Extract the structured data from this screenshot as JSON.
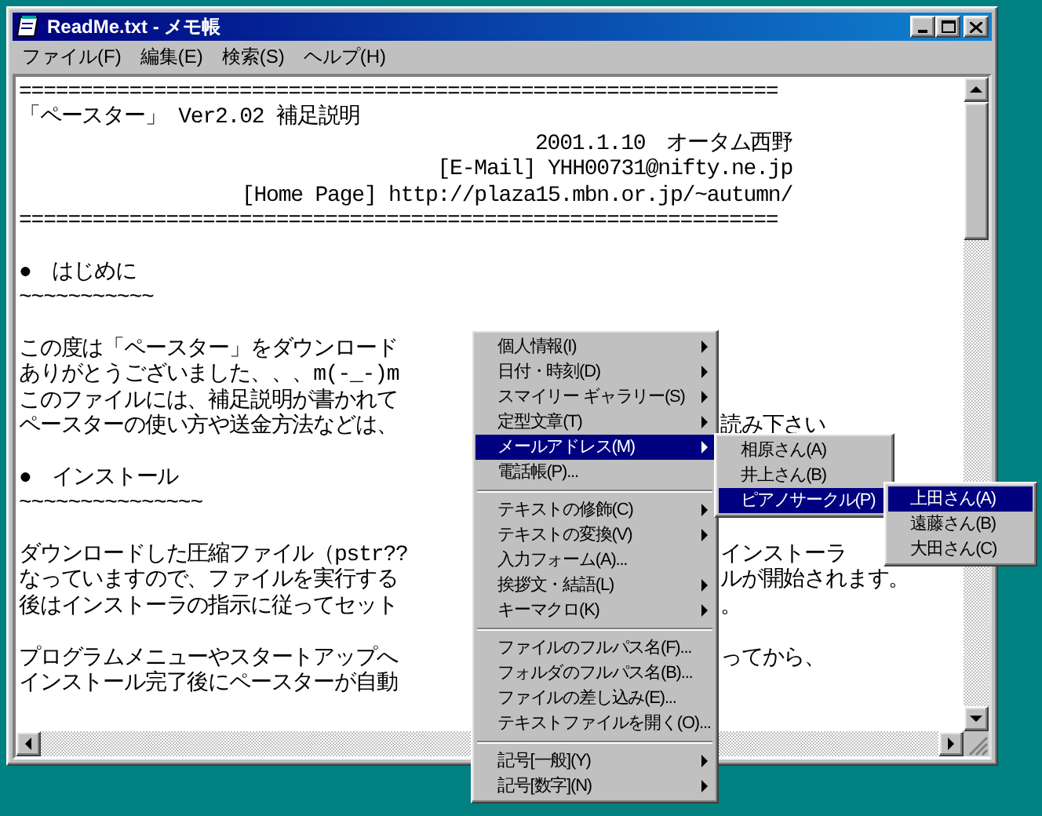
{
  "window": {
    "title": "ReadMe.txt - メモ帳"
  },
  "menu_bar": [
    "ファイル(F)",
    "編集(E)",
    "検索(S)",
    "ヘルプ(H)"
  ],
  "document": {
    "lines": [
      {
        "kind": "text",
        "text": "=============================================================="
      },
      {
        "kind": "text",
        "text": "「ペースター」 Ver2.02 補足説明"
      },
      {
        "kind": "right",
        "text": "2001.1.10　オータム西野"
      },
      {
        "kind": "right",
        "text": "[E-Mail] YHH00731@nifty.ne.jp"
      },
      {
        "kind": "right",
        "text": "[Home Page] http://plaza15.mbn.or.jp/~autumn/"
      },
      {
        "kind": "text",
        "text": "=============================================================="
      },
      {
        "kind": "blank"
      },
      {
        "kind": "text",
        "text": "●　はじめに"
      },
      {
        "kind": "text",
        "text": "~~~~~~~~~~~"
      },
      {
        "kind": "blank"
      },
      {
        "kind": "text",
        "text": "この度は「ペースター」をダウンロード"
      },
      {
        "kind": "text",
        "text": "ありがとうございました、、、m(-_-)m"
      },
      {
        "kind": "text",
        "text": "このファイルには、補足説明が書かれて"
      },
      {
        "kind": "text",
        "text": "ペースターの使い方や送金方法などは、",
        "tail": "読み下さい"
      },
      {
        "kind": "blank"
      },
      {
        "kind": "text",
        "text": "●　インストール"
      },
      {
        "kind": "text",
        "text": "~~~~~~~~~~~~~~~"
      },
      {
        "kind": "blank"
      },
      {
        "kind": "text",
        "text": "ダウンロードした圧縮ファイル（pstr??",
        "tail": "インストーラ"
      },
      {
        "kind": "text",
        "text": "なっていますので、ファイルを実行する",
        "tail": "ルが開始されます。"
      },
      {
        "kind": "text",
        "text": "後はインストーラの指示に従ってセット",
        "tail": "。"
      },
      {
        "kind": "blank"
      },
      {
        "kind": "text",
        "text": "プログラムメニューやスタートアップへ",
        "tail": "ってから、"
      },
      {
        "kind": "text",
        "text": "インストール完了後にペースターが自動"
      }
    ]
  },
  "context_menu": {
    "items": [
      {
        "kind": "submenu",
        "label": "個人情報(I)",
        "selected": false
      },
      {
        "kind": "submenu",
        "label": "日付・時刻(D)",
        "selected": false
      },
      {
        "kind": "submenu",
        "label": "スマイリー ギャラリー(S)",
        "selected": false
      },
      {
        "kind": "submenu",
        "label": "定型文章(T)",
        "selected": false
      },
      {
        "kind": "submenu",
        "label": "メールアドレス(M)",
        "selected": true
      },
      {
        "kind": "item",
        "label": "電話帳(P)...",
        "selected": false
      },
      {
        "kind": "separator"
      },
      {
        "kind": "submenu",
        "label": "テキストの修飾(C)",
        "selected": false
      },
      {
        "kind": "submenu",
        "label": "テキストの変換(V)",
        "selected": false
      },
      {
        "kind": "item",
        "label": "入力フォーム(A)...",
        "selected": false
      },
      {
        "kind": "submenu",
        "label": "挨拶文・結語(L)",
        "selected": false
      },
      {
        "kind": "submenu",
        "label": "キーマクロ(K)",
        "selected": false
      },
      {
        "kind": "separator"
      },
      {
        "kind": "item",
        "label": "ファイルのフルパス名(F)...",
        "selected": false
      },
      {
        "kind": "item",
        "label": "フォルダのフルパス名(B)...",
        "selected": false
      },
      {
        "kind": "item",
        "label": "ファイルの差し込み(E)...",
        "selected": false
      },
      {
        "kind": "item",
        "label": "テキストファイルを開く(O)...",
        "selected": false
      },
      {
        "kind": "separator"
      },
      {
        "kind": "submenu",
        "label": "記号[一般](Y)",
        "selected": false
      },
      {
        "kind": "submenu",
        "label": "記号[数字](N)",
        "selected": false
      }
    ]
  },
  "submenu": {
    "items": [
      {
        "kind": "item",
        "label": "相原さん(A)",
        "selected": false
      },
      {
        "kind": "item",
        "label": "井上さん(B)",
        "selected": false
      },
      {
        "kind": "submenu",
        "label": "ピアノサークル(P)",
        "selected": true
      }
    ]
  },
  "submenu_2": {
    "items": [
      {
        "kind": "item",
        "label": "上田さん(A)",
        "selected": true
      },
      {
        "kind": "item",
        "label": "遠藤さん(B)",
        "selected": false
      },
      {
        "kind": "item",
        "label": "大田さん(C)",
        "selected": false
      }
    ]
  }
}
